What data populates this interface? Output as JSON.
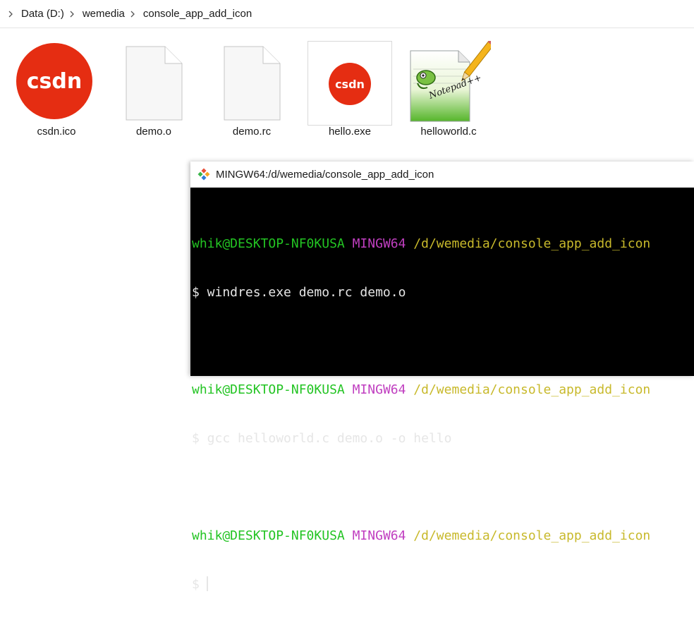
{
  "breadcrumb": {
    "items": [
      "Data (D:)",
      "wemedia",
      "console_app_add_icon"
    ]
  },
  "files": [
    {
      "name": "csdn.ico",
      "icon": "csdn-logo-icon"
    },
    {
      "name": "demo.o",
      "icon": "blank-file-icon"
    },
    {
      "name": "demo.rc",
      "icon": "blank-file-icon"
    },
    {
      "name": "hello.exe",
      "icon": "csdn-logo-icon"
    },
    {
      "name": "helloworld.c",
      "icon": "notepad-plus-plus-icon"
    }
  ],
  "logo_text": "csdn",
  "notepad_text": "Notepad++",
  "terminal": {
    "title": "MINGW64:/d/wemedia/console_app_add_icon",
    "prompts": [
      {
        "user": "whik@DESKTOP-NF0KUSA",
        "host": "MINGW64",
        "path": "/d/wemedia/console_app_add_icon",
        "command": "$ windres.exe demo.rc demo.o"
      },
      {
        "user": "whik@DESKTOP-NF0KUSA",
        "host": "MINGW64",
        "path": "/d/wemedia/console_app_add_icon",
        "command": "$ gcc helloworld.c demo.o -o hello"
      },
      {
        "user": "whik@DESKTOP-NF0KUSA",
        "host": "MINGW64",
        "path": "/d/wemedia/console_app_add_icon",
        "command": "$"
      }
    ]
  },
  "colors": {
    "csdn_red": "#e52d12",
    "terminal_bg": "#000000",
    "prompt_user": "#23c423",
    "prompt_host": "#c03fc0",
    "prompt_path": "#c8b92b"
  }
}
